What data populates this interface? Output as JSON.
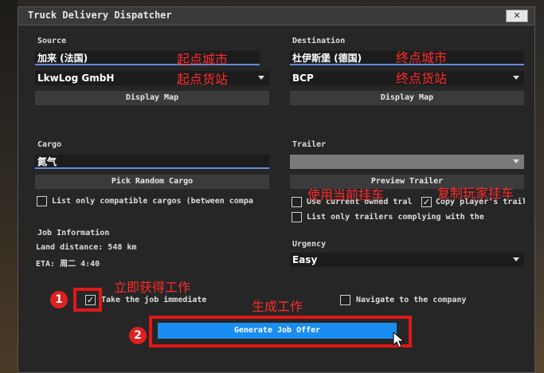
{
  "window": {
    "title": "Truck Delivery Dispatcher",
    "close_label": "✕"
  },
  "source": {
    "label": "Source",
    "city_value": "加来 (法国)",
    "company_value": "LkwLog GmbH",
    "display_map": "Display Map"
  },
  "destination": {
    "label": "Destination",
    "city_value": "杜伊斯堡 (德国)",
    "company_value": "BCP",
    "display_map": "Display Map"
  },
  "cargo": {
    "label": "Cargo",
    "value": "氮气",
    "pick_random": "Pick Random Cargo",
    "compatible_only": "List only compatible cargos (between compa"
  },
  "trailer": {
    "label": "Trailer",
    "value": "",
    "preview": "Preview Trailer",
    "use_current": "Use current owned tral",
    "copy_player": "Copy player's traile",
    "list_complying": "List only trailers complying with the"
  },
  "job_info": {
    "heading": "Job Information",
    "land_distance": "Land distance: 548 km",
    "eta": "ETA: 周二 4:40"
  },
  "urgency": {
    "label": "Urgency",
    "value": "Easy"
  },
  "options": {
    "take_job": "Take the job immediate",
    "take_job_checked": true,
    "navigate": "Navigate to the company",
    "navigate_checked": false
  },
  "generate_button": "Generate Job Offer",
  "annotations": {
    "start_city": "起点城市",
    "start_depot": "起点货站",
    "end_city": "终点城市",
    "end_depot": "终点货站",
    "use_current_trailer": "使用当前挂车",
    "copy_player_trailer": "复制玩家挂车",
    "get_job_now": "立即获得工作",
    "generate_job": "生成工作",
    "step1": "1",
    "step2": "2"
  },
  "colors": {
    "accent_blue": "#1a8df0",
    "annotation_red": "#ff2a2a",
    "underline_blue": "#5e8de0"
  }
}
